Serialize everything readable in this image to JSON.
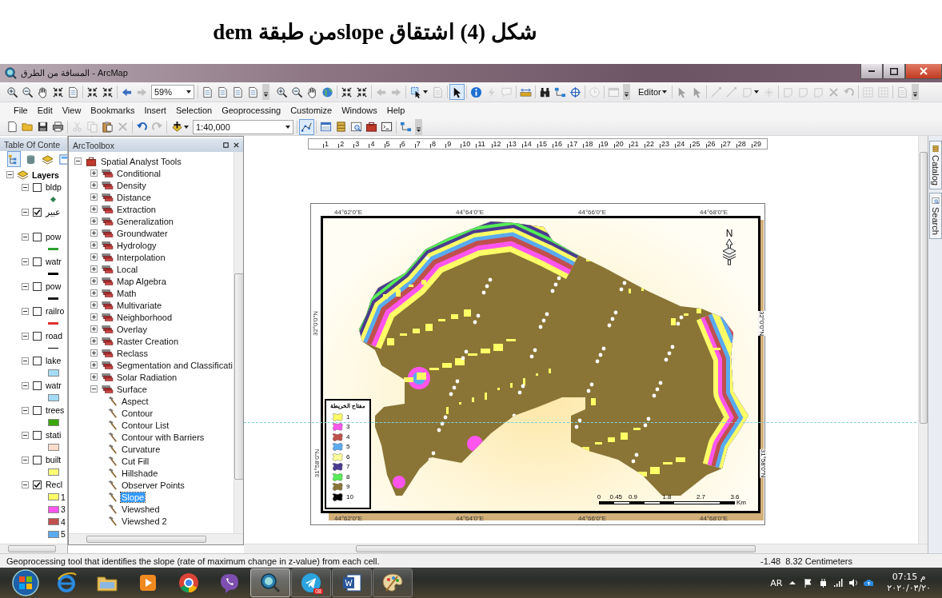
{
  "caption": "شكل (4) اشتقاق slopeمن طبقة dem",
  "window": {
    "title": "المسافة من الطرق - ArcMap"
  },
  "toolbar_rows": [
    {
      "items": [
        {
          "kind": "button",
          "disabled": false,
          "pressed": false
        },
        {
          "kind": "button",
          "disabled": false,
          "pressed": false
        },
        {
          "kind": "button",
          "disabled": false,
          "pressed": false
        },
        {
          "kind": "button",
          "disabled": false,
          "pressed": false
        },
        {
          "kind": "button",
          "disabled": false,
          "pressed": false
        },
        {
          "kind": "separator"
        },
        {
          "kind": "button",
          "disabled": false,
          "pressed": false
        },
        {
          "kind": "button",
          "disabled": false,
          "pressed": false
        },
        {
          "kind": "separator"
        },
        {
          "kind": "button",
          "disabled": false,
          "pressed": false
        },
        {
          "kind": "button",
          "disabled": true,
          "pressed": false
        },
        {
          "kind": "combo",
          "value": "59%"
        },
        {
          "kind": "separator"
        },
        {
          "kind": "button",
          "disabled": false,
          "pressed": false
        },
        {
          "kind": "button",
          "disabled": false,
          "pressed": false
        },
        {
          "kind": "button",
          "disabled": false,
          "pressed": false
        },
        {
          "kind": "button",
          "disabled": false,
          "pressed": false
        },
        {
          "kind": "grip"
        },
        {
          "kind": "button",
          "disabled": false,
          "pressed": false
        },
        {
          "kind": "button",
          "disabled": false,
          "pressed": false
        },
        {
          "kind": "button",
          "disabled": false,
          "pressed": false
        },
        {
          "kind": "button",
          "disabled": false,
          "pressed": false
        },
        {
          "kind": "separator"
        },
        {
          "kind": "button",
          "disabled": false,
          "pressed": false
        },
        {
          "kind": "button",
          "disabled": false,
          "pressed": false
        },
        {
          "kind": "separator"
        },
        {
          "kind": "button",
          "disabled": true,
          "pressed": false
        },
        {
          "kind": "button",
          "disabled": true,
          "pressed": false
        },
        {
          "kind": "separator"
        },
        {
          "kind": "button",
          "disabled": false,
          "pressed": false
        },
        {
          "kind": "button",
          "disabled": true,
          "pressed": false
        },
        {
          "kind": "separator"
        },
        {
          "kind": "button",
          "disabled": false,
          "pressed": true
        },
        {
          "kind": "separator"
        },
        {
          "kind": "button",
          "disabled": false,
          "pressed": false
        },
        {
          "kind": "button",
          "disabled": true,
          "pressed": false
        },
        {
          "kind": "button",
          "disabled": true,
          "pressed": false
        },
        {
          "kind": "separator"
        },
        {
          "kind": "button",
          "disabled": false,
          "pressed": false
        },
        {
          "kind": "separator"
        },
        {
          "kind": "button",
          "disabled": false,
          "pressed": false
        },
        {
          "kind": "button",
          "disabled": false,
          "pressed": false
        },
        {
          "kind": "button",
          "disabled": false,
          "pressed": false
        },
        {
          "kind": "separator"
        },
        {
          "kind": "button",
          "disabled": true,
          "pressed": false
        },
        {
          "kind": "separator"
        },
        {
          "kind": "button",
          "disabled": true,
          "pressed": false
        },
        {
          "kind": "grip"
        },
        {
          "kind": "menu",
          "label": "Editor"
        },
        {
          "kind": "separator"
        },
        {
          "kind": "button",
          "disabled": true,
          "pressed": false
        },
        {
          "kind": "button",
          "disabled": true,
          "pressed": false
        },
        {
          "kind": "separator"
        },
        {
          "kind": "button",
          "disabled": true,
          "pressed": false
        },
        {
          "kind": "button",
          "disabled": true,
          "pressed": false
        },
        {
          "kind": "button",
          "disabled": true,
          "pressed": false
        },
        {
          "kind": "button",
          "disabled": true,
          "pressed": false
        },
        {
          "kind": "separator"
        },
        {
          "kind": "button",
          "disabled": true,
          "pressed": false
        },
        {
          "kind": "button",
          "disabled": true,
          "pressed": false
        },
        {
          "kind": "button",
          "disabled": true,
          "pressed": false
        },
        {
          "kind": "button",
          "disabled": true,
          "pressed": false
        },
        {
          "kind": "button",
          "disabled": true,
          "pressed": false
        },
        {
          "kind": "separator"
        },
        {
          "kind": "button",
          "disabled": true,
          "pressed": false
        },
        {
          "kind": "button",
          "disabled": true,
          "pressed": false
        },
        {
          "kind": "separator"
        },
        {
          "kind": "button",
          "disabled": true,
          "pressed": false
        },
        {
          "kind": "grip"
        }
      ]
    },
    {
      "items": [
        {
          "kind": "button",
          "disabled": false,
          "pressed": false
        },
        {
          "kind": "button",
          "disabled": false,
          "pressed": false
        },
        {
          "kind": "button",
          "disabled": false,
          "pressed": false
        },
        {
          "kind": "button",
          "disabled": false,
          "pressed": false
        },
        {
          "kind": "separator"
        },
        {
          "kind": "button",
          "disabled": true,
          "pressed": false
        },
        {
          "kind": "button",
          "disabled": true,
          "pressed": false
        },
        {
          "kind": "button",
          "disabled": false,
          "pressed": false
        },
        {
          "kind": "button",
          "disabled": true,
          "pressed": false
        },
        {
          "kind": "separator"
        },
        {
          "kind": "button",
          "disabled": false,
          "pressed": false
        },
        {
          "kind": "button",
          "disabled": true,
          "pressed": false
        },
        {
          "kind": "separator"
        },
        {
          "kind": "button",
          "disabled": false,
          "pressed": false
        },
        {
          "kind": "combo",
          "value": "1:40,000"
        },
        {
          "kind": "separator"
        },
        {
          "kind": "button",
          "disabled": false,
          "pressed": true
        },
        {
          "kind": "separator"
        },
        {
          "kind": "button",
          "disabled": false,
          "pressed": false
        },
        {
          "kind": "button",
          "disabled": false,
          "pressed": false
        },
        {
          "kind": "button",
          "disabled": false,
          "pressed": false
        },
        {
          "kind": "button",
          "disabled": false,
          "pressed": false
        },
        {
          "kind": "button",
          "disabled": false,
          "pressed": false
        },
        {
          "kind": "separator"
        },
        {
          "kind": "button",
          "disabled": false,
          "pressed": false
        },
        {
          "kind": "grip"
        }
      ]
    }
  ],
  "menu_bar": [
    "File",
    "Edit",
    "View",
    "Bookmarks",
    "Insert",
    "Selection",
    "Geoprocessing",
    "Customize",
    "Windows",
    "Help"
  ],
  "table_of_contents": {
    "title": "Table Of Conte",
    "root": {
      "label": "Layers",
      "expanded": true
    },
    "layers": [
      {
        "name": "bldp",
        "checked": false,
        "expanded": true,
        "symbol": {
          "kind": "point",
          "color": "#2e7d4f"
        }
      },
      {
        "name": "عبير",
        "checked": true,
        "expanded": true
      },
      {
        "name": "pow",
        "checked": false,
        "expanded": true,
        "symbol": {
          "kind": "line",
          "color": "#2ca02c"
        }
      },
      {
        "name": "watr",
        "checked": false,
        "expanded": true,
        "symbol": {
          "kind": "line",
          "color": "#000000"
        }
      },
      {
        "name": "pow",
        "checked": false,
        "expanded": true,
        "symbol": {
          "kind": "line",
          "color": "#1a1a1a"
        }
      },
      {
        "name": "railro",
        "checked": false,
        "expanded": true,
        "symbol": {
          "kind": "line",
          "color": "#e03030"
        }
      },
      {
        "name": "road",
        "checked": false,
        "expanded": true,
        "symbol": {
          "kind": "thin-line",
          "color": "#000000"
        }
      },
      {
        "name": "lake",
        "checked": false,
        "expanded": true,
        "symbol": {
          "kind": "fill",
          "color": "#a3dbf5"
        }
      },
      {
        "name": "watr",
        "checked": false,
        "expanded": true,
        "symbol": {
          "kind": "fill",
          "color": "#a3dbf5"
        }
      },
      {
        "name": "trees",
        "checked": false,
        "expanded": true,
        "symbol": {
          "kind": "fill",
          "color": "#38a800"
        }
      },
      {
        "name": "stati",
        "checked": false,
        "expanded": true,
        "symbol": {
          "kind": "fill",
          "color": "#fadccb"
        }
      },
      {
        "name": "built",
        "checked": false,
        "expanded": true,
        "symbol": {
          "kind": "fill",
          "color": "#ffff73"
        }
      },
      {
        "name": "Recl",
        "checked": true,
        "expanded": true,
        "classes": [
          {
            "label": "1",
            "color": "#ffff66"
          },
          {
            "label": "3",
            "color": "#ff55ee"
          },
          {
            "label": "4",
            "color": "#c0504d"
          },
          {
            "label": "5",
            "color": "#5aaaf0"
          }
        ]
      }
    ]
  },
  "arctoolbox": {
    "title": "ArcToolbox",
    "tree": [
      {
        "kind": "toolbox",
        "label": "Spatial Analyst Tools",
        "expanded": true,
        "children": [
          {
            "kind": "toolset",
            "label": "Conditional",
            "expanded": false
          },
          {
            "kind": "toolset",
            "label": "Density",
            "expanded": false
          },
          {
            "kind": "toolset",
            "label": "Distance",
            "expanded": false
          },
          {
            "kind": "toolset",
            "label": "Extraction",
            "expanded": false
          },
          {
            "kind": "toolset",
            "label": "Generalization",
            "expanded": false
          },
          {
            "kind": "toolset",
            "label": "Groundwater",
            "expanded": false
          },
          {
            "kind": "toolset",
            "label": "Hydrology",
            "expanded": false
          },
          {
            "kind": "toolset",
            "label": "Interpolation",
            "expanded": false
          },
          {
            "kind": "toolset",
            "label": "Local",
            "expanded": false
          },
          {
            "kind": "toolset",
            "label": "Map Algebra",
            "expanded": false
          },
          {
            "kind": "toolset",
            "label": "Math",
            "expanded": false
          },
          {
            "kind": "toolset",
            "label": "Multivariate",
            "expanded": false
          },
          {
            "kind": "toolset",
            "label": "Neighborhood",
            "expanded": false
          },
          {
            "kind": "toolset",
            "label": "Overlay",
            "expanded": false
          },
          {
            "kind": "toolset",
            "label": "Raster Creation",
            "expanded": false
          },
          {
            "kind": "toolset",
            "label": "Reclass",
            "expanded": false
          },
          {
            "kind": "toolset",
            "label": "Segmentation and Classificati",
            "expanded": false
          },
          {
            "kind": "toolset",
            "label": "Solar Radiation",
            "expanded": false
          },
          {
            "kind": "toolset",
            "label": "Surface",
            "expanded": true,
            "children": [
              {
                "kind": "tool",
                "label": "Aspect",
                "selected": false
              },
              {
                "kind": "tool",
                "label": "Contour",
                "selected": false
              },
              {
                "kind": "tool",
                "label": "Contour List",
                "selected": false
              },
              {
                "kind": "tool",
                "label": "Contour with Barriers",
                "selected": false
              },
              {
                "kind": "tool",
                "label": "Curvature",
                "selected": false
              },
              {
                "kind": "tool",
                "label": "Cut Fill",
                "selected": false
              },
              {
                "kind": "tool",
                "label": "Hillshade",
                "selected": false
              },
              {
                "kind": "tool",
                "label": "Observer Points",
                "selected": false
              },
              {
                "kind": "tool",
                "label": "Slope",
                "selected": true
              },
              {
                "kind": "tool",
                "label": "Viewshed",
                "selected": false
              },
              {
                "kind": "tool",
                "label": "Viewshed 2",
                "selected": false
              }
            ]
          }
        ]
      }
    ]
  },
  "ruler": [
    "1",
    "2",
    "3",
    "4",
    "5",
    "6",
    "7",
    "8",
    "9",
    "10",
    "11",
    "12",
    "13",
    "14",
    "15",
    "16",
    "17",
    "18",
    "19",
    "20",
    "21",
    "22",
    "23",
    "24",
    "25",
    "26",
    "27",
    "28",
    "29"
  ],
  "layout": {
    "top_labels": [
      "44°62'0\"E",
      "44°64'0\"E",
      "44°66'0\"E",
      "44°68'0\"E"
    ],
    "bottom_labels": [
      "44°62'0\"E",
      "44°64'0\"E",
      "44°66'0\"E",
      "44°68'0\"E"
    ],
    "left_labels": [
      "32°0'0\"N",
      "31°58'0\"N"
    ],
    "right_labels": [
      "32°0'0\"N",
      "31°58'0\"N"
    ],
    "north": "N",
    "legend": {
      "title": "مفتاح الخريطة",
      "items": [
        {
          "label": "1",
          "color": "#ffff66"
        },
        {
          "label": "3",
          "color": "#ff55ee"
        },
        {
          "label": "4",
          "color": "#c0504d"
        },
        {
          "label": "5",
          "color": "#5aaaf0"
        },
        {
          "label": "6",
          "color": "#ffff99"
        },
        {
          "label": "7",
          "color": "#4a3a90"
        },
        {
          "label": "8",
          "color": "#55ee55"
        },
        {
          "label": "9",
          "color": "#8a7536"
        },
        {
          "label": "10",
          "color": "#000000"
        }
      ]
    },
    "scale": {
      "ticks": [
        "0",
        "0.45",
        "0.9",
        "1.8",
        "2.7",
        "3.6"
      ],
      "unit": "Km"
    }
  },
  "side_tabs": [
    "Catalog",
    "Search"
  ],
  "status_bar": {
    "message": "Geoprocessing tool that identifies the slope (rate of maximum change in z-value) from each cell.",
    "coordinates": "-1.48  8.32 Centimeters"
  },
  "taskbar": {
    "apps": [
      {
        "running": false,
        "active": false
      },
      {
        "running": false,
        "active": false
      },
      {
        "running": false,
        "active": false
      },
      {
        "running": false,
        "active": false
      },
      {
        "running": false,
        "active": false
      },
      {
        "running": true,
        "active": true
      },
      {
        "running": true,
        "active": false,
        "badge": "08"
      },
      {
        "running": true,
        "active": false
      },
      {
        "running": true,
        "active": false
      }
    ],
    "language": "AR",
    "time": "07:15 م",
    "date": "٢٠٢٠/٠٣/٢٠"
  }
}
